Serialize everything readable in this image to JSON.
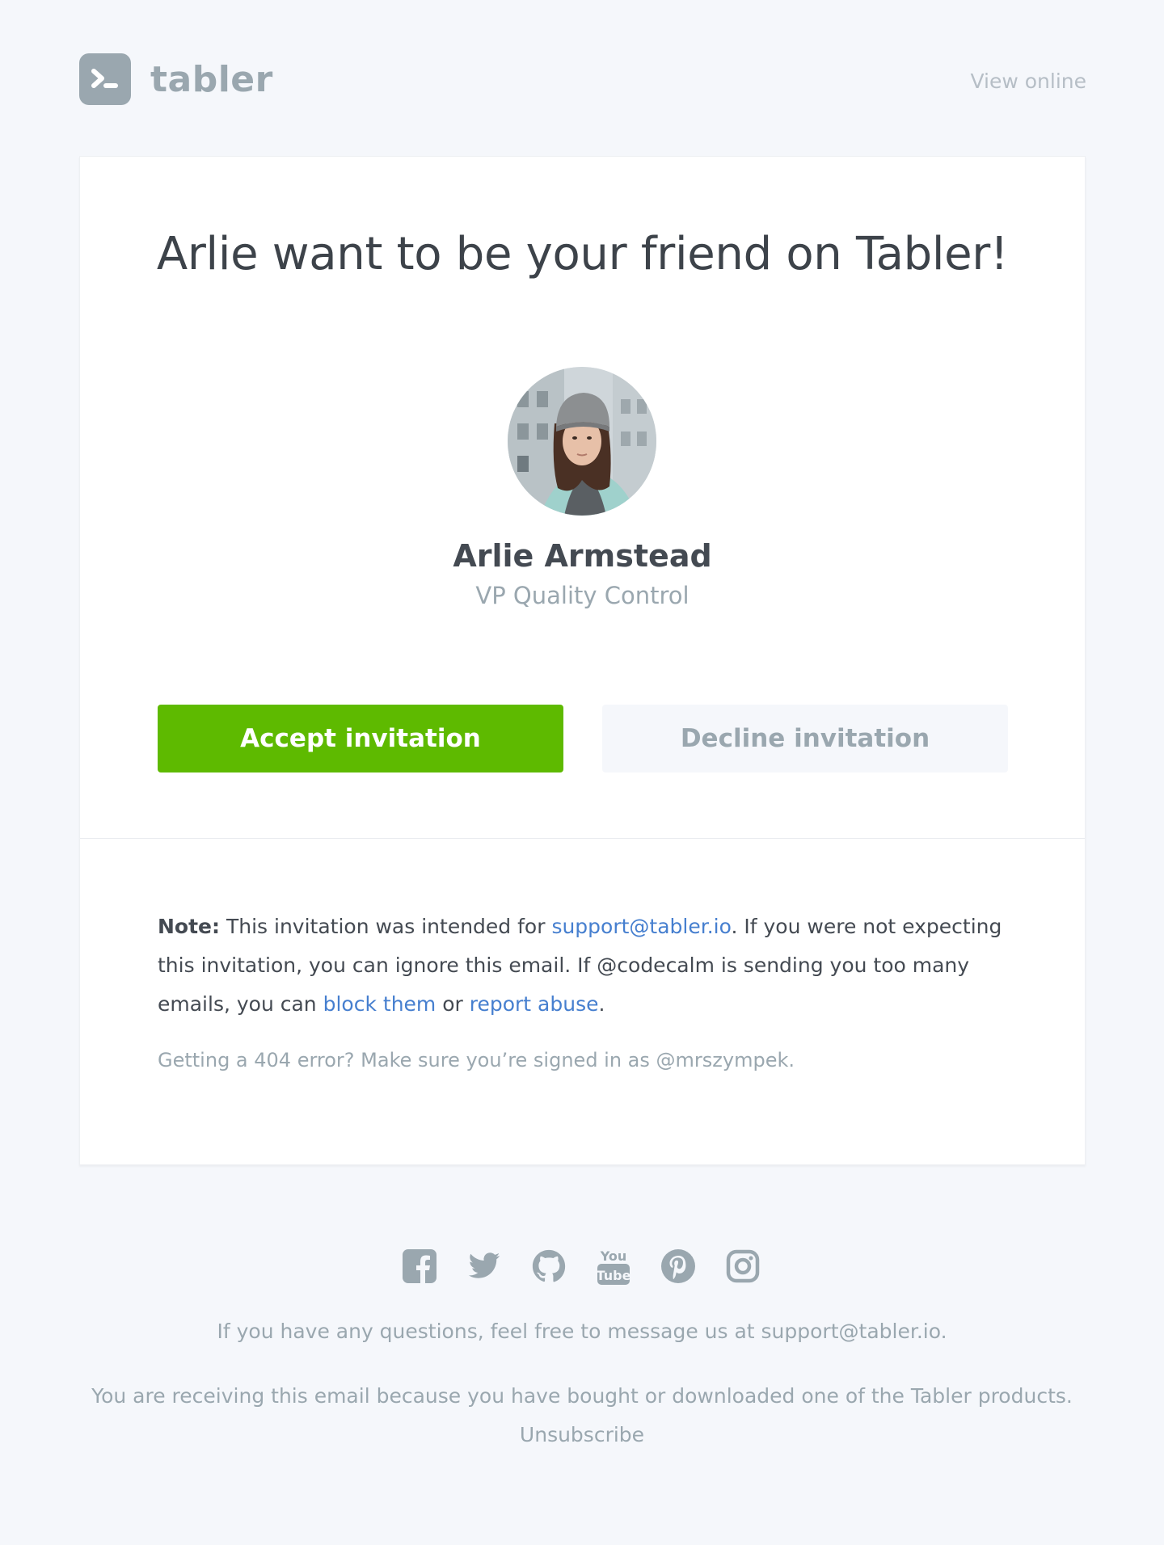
{
  "header": {
    "logo_text": "tabler",
    "view_online": "View online"
  },
  "card": {
    "title": "Arlie want to be your friend on Tabler!",
    "person": {
      "name": "Arlie Armstead",
      "role": "VP Quality Control"
    },
    "buttons": {
      "accept": "Accept invitation",
      "decline": "Decline invitation"
    },
    "note": {
      "label": "Note:",
      "text1": " This invitation was intended for ",
      "email_link": "support@tabler.io",
      "text2": ". If you were not expecting this invitation, you can ignore this email. If @codecalm is sending you too many emails, you can ",
      "block_link": "block them",
      "text3": " or ",
      "report_link": "report abuse",
      "text4": "."
    },
    "hint": "Getting a 404 error? Make sure you’re signed in as @mrszympek."
  },
  "footer": {
    "socials": [
      "facebook-icon",
      "twitter-icon",
      "github-icon",
      "youtube-icon",
      "pinterest-icon",
      "instagram-icon"
    ],
    "questions": "If you have any questions, feel free to message us at support@tabler.io.",
    "receiving": "You are receiving this email because you have bought or downloaded one of the Tabler products.",
    "unsubscribe": "Unsubscribe"
  },
  "colors": {
    "background": "#f5f7fb",
    "accept": "#5eba00",
    "link": "#467fcf",
    "muted": "#9aa7af"
  }
}
